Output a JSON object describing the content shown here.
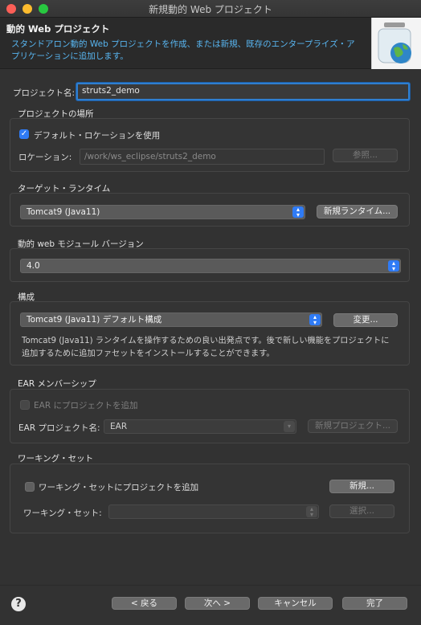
{
  "window": {
    "title": "新規動的 Web プロジェクト"
  },
  "header": {
    "title": "動的 Web プロジェクト",
    "description": "スタンドアロン動的 Web プロジェクトを作成、または新規、既存のエンタープライズ・アプリケーションに追加します。"
  },
  "project_name": {
    "label": "プロジェクト名:",
    "value": "struts2_demo"
  },
  "location": {
    "section": "プロジェクトの場所",
    "use_default_label": "デフォルト・ロケーションを使用",
    "use_default_checked": true,
    "location_label": "ロケーション:",
    "location_value": "/work/ws_eclipse/struts2_demo",
    "browse_label": "参照..."
  },
  "target_runtime": {
    "section": "ターゲット・ランタイム",
    "selected": "Tomcat9 (Java11)",
    "new_runtime_label": "新規ランタイム..."
  },
  "module_version": {
    "section": "動的 web モジュール バージョン",
    "selected": "4.0"
  },
  "configuration": {
    "section": "構成",
    "selected": "Tomcat9 (Java11) デフォルト構成",
    "modify_label": "変更...",
    "description_line1": "Tomcat9 (Java11) ランタイムを操作するための良い出発点です。後で新しい機能をプロジェクトに",
    "description_line2": "追加するために追加ファセットをインストールすることができます。"
  },
  "ear": {
    "section": "EAR メンバーシップ",
    "add_label": "EAR にプロジェクトを追加",
    "project_label": "EAR プロジェクト名:",
    "project_value": "EAR",
    "new_project_label": "新規プロジェクト..."
  },
  "working_set": {
    "section": "ワーキング・セット",
    "add_label": "ワーキング・セットにプロジェクトを追加",
    "new_label": "新規...",
    "set_label": "ワーキング・セット:",
    "select_label": "選択..."
  },
  "footer": {
    "help_glyph": "?",
    "back_label": "< 戻る",
    "next_label": "次へ >",
    "cancel_label": "キャンセル",
    "finish_label": "完了"
  }
}
